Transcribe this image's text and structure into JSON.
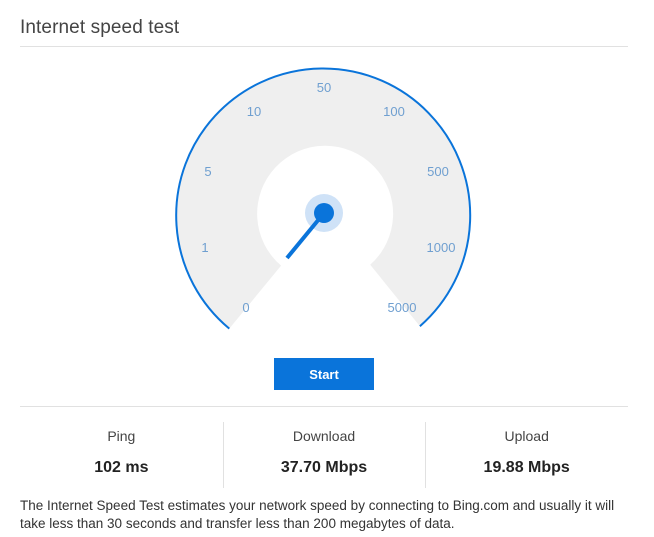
{
  "header": {
    "title": "Internet speed test"
  },
  "gauge": {
    "scale_labels": [
      "0",
      "1",
      "5",
      "10",
      "50",
      "100",
      "500",
      "1000",
      "5000"
    ],
    "needle_value_label": "1",
    "colors": {
      "arc": "#0a74da",
      "dial_fill": "#efefef",
      "tick_text": "#6f9fd0",
      "needle": "#0a74da",
      "needle_halo": "#cfe2f7"
    }
  },
  "actions": {
    "start_label": "Start"
  },
  "results": {
    "ping": {
      "label": "Ping",
      "value": "102 ms"
    },
    "download": {
      "label": "Download",
      "value": "37.70 Mbps"
    },
    "upload": {
      "label": "Upload",
      "value": "19.88 Mbps"
    }
  },
  "footer": {
    "description": "The Internet Speed Test estimates your network speed by connecting to Bing.com and usually it will take less than 30 seconds and transfer less than 200 megabytes of data."
  },
  "theme": {
    "accent": "#0a74da",
    "divider": "#e1e1e1"
  }
}
